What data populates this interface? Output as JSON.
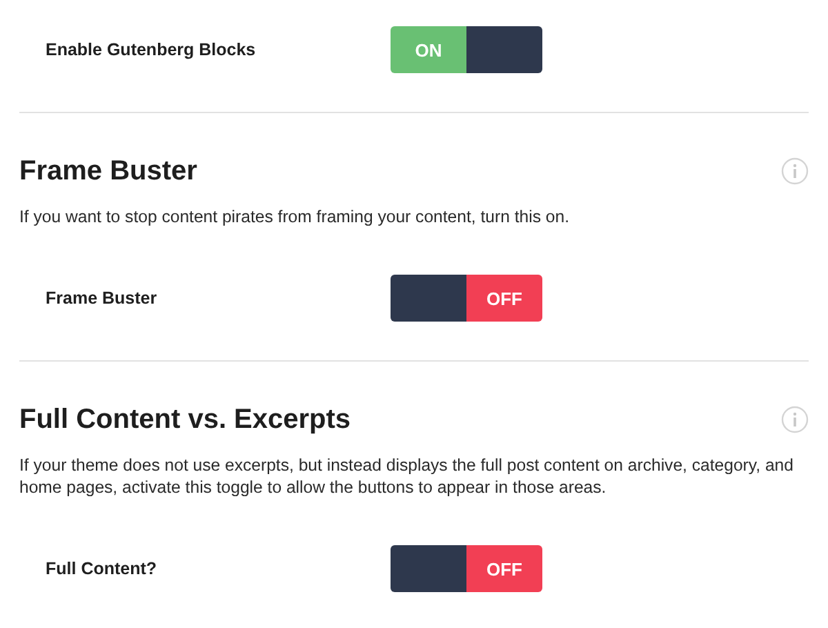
{
  "sections": [
    {
      "rows": [
        {
          "label": "Enable Gutenberg Blocks",
          "on": true,
          "state_text": "ON"
        }
      ]
    },
    {
      "heading": "Frame Buster",
      "description": "If you want to stop content pirates from framing your content, turn this on.",
      "rows": [
        {
          "label": "Frame Buster",
          "on": false,
          "state_text": "OFF"
        }
      ]
    },
    {
      "heading": "Full Content vs. Excerpts",
      "description": "If your theme does not use excerpts, but instead displays the full post content on archive, category, and home pages, activate this toggle to allow the buttons to appear in those areas.",
      "rows": [
        {
          "label": "Full Content?",
          "on": false,
          "state_text": "OFF"
        }
      ]
    }
  ]
}
